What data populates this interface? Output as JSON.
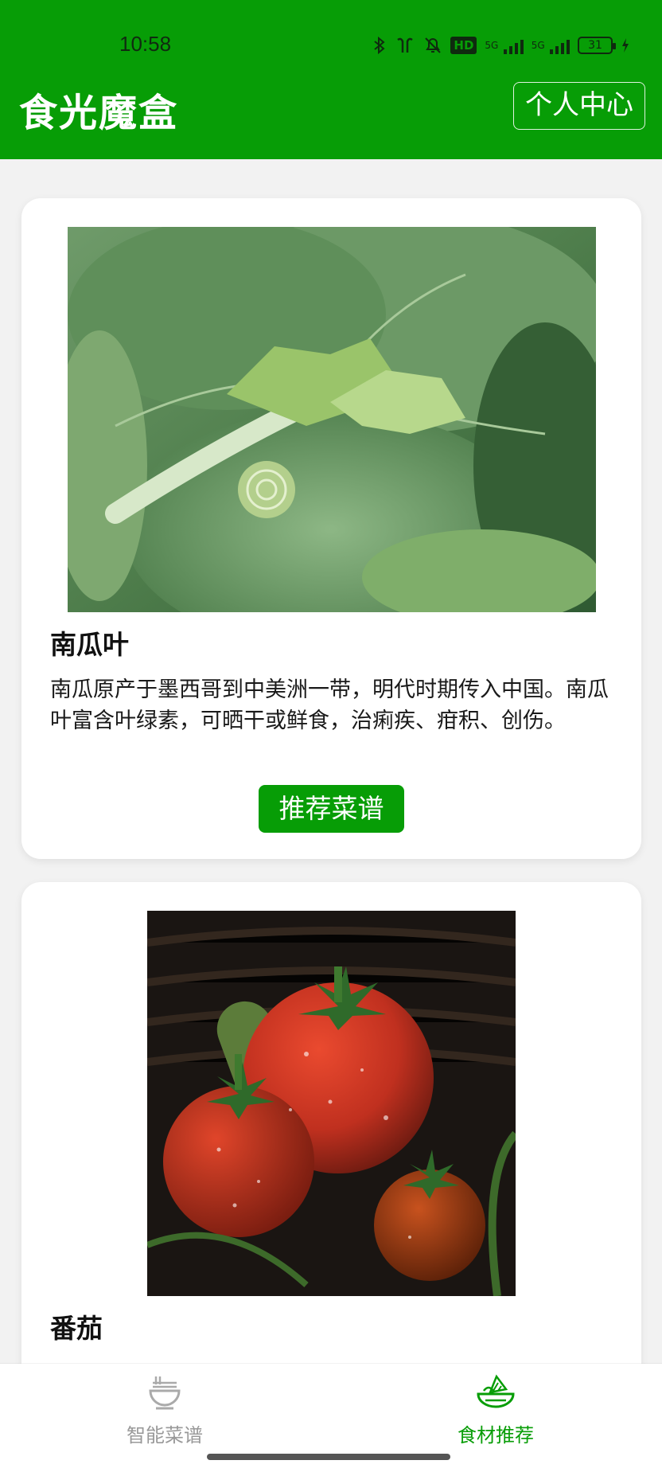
{
  "status_bar": {
    "time": "10:58",
    "network_labels": [
      "5G",
      "5G"
    ],
    "battery": "31",
    "hd_badge": "HD"
  },
  "header": {
    "title": "食光魔盒",
    "profile_button": "个人中心"
  },
  "cards": [
    {
      "name": "南瓜叶",
      "description": "南瓜原产于墨西哥到中美洲一带，明代时期传入中国。南瓜叶富含叶绿素，可晒干或鲜食，治痢疾、疳积、创伤。",
      "button": "推荐菜谱",
      "image_icon": "pumpkin-leaf-photo"
    },
    {
      "name": "番茄",
      "description": "",
      "image_icon": "tomato-photo"
    }
  ],
  "bottom_nav": {
    "items": [
      {
        "label": "智能菜谱",
        "icon": "bowl-icon",
        "active": false
      },
      {
        "label": "食材推荐",
        "icon": "veggie-basket-icon",
        "active": true
      }
    ]
  },
  "colors": {
    "brand_green": "#079d06",
    "inactive_gray": "#999999"
  }
}
